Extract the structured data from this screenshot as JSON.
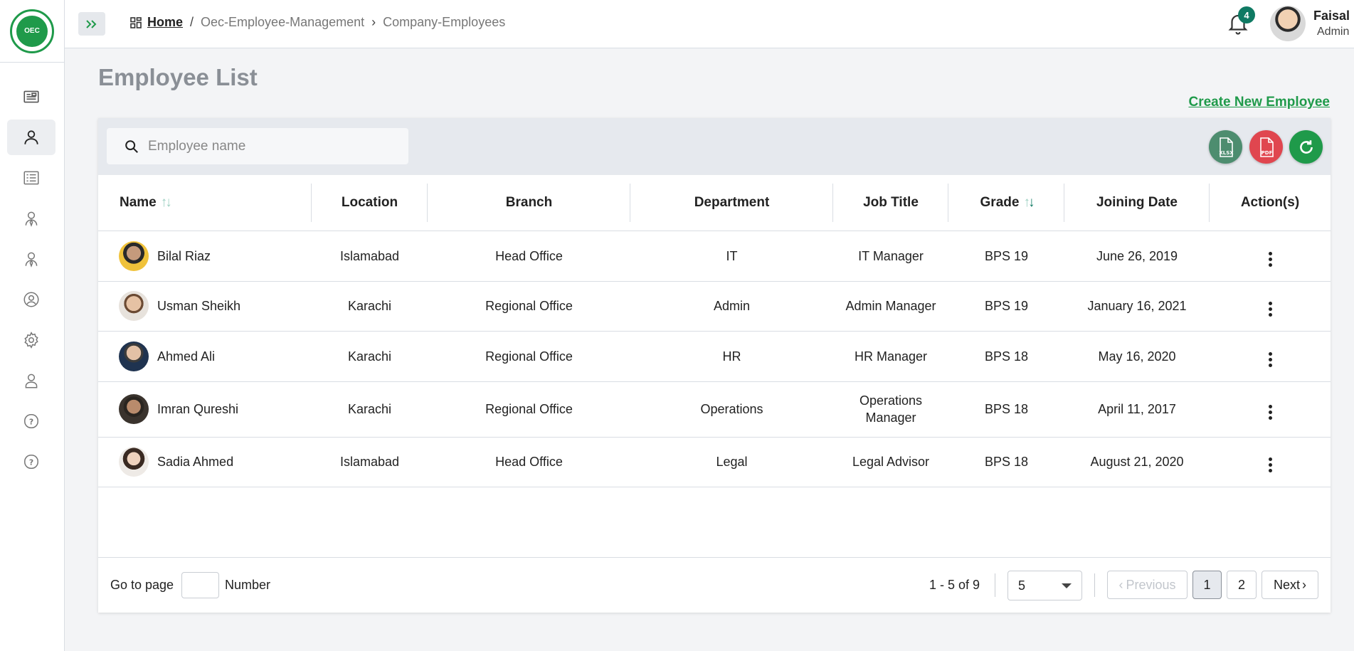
{
  "sidebar": {
    "logo_text": "OEC",
    "items": [
      {
        "icon": "id-card-icon"
      },
      {
        "icon": "user-icon",
        "active": true
      },
      {
        "icon": "list-icon"
      },
      {
        "icon": "employee-icon"
      },
      {
        "icon": "employee-alt-icon"
      },
      {
        "icon": "user-circle-icon"
      },
      {
        "icon": "gear-icon"
      },
      {
        "icon": "person-icon"
      },
      {
        "icon": "help-icon"
      },
      {
        "icon": "help-alt-icon"
      }
    ]
  },
  "breadcrumb": {
    "home": "Home",
    "sep1": "/",
    "module": "Oec-Employee-Management",
    "sep2": "›",
    "page": "Company-Employees"
  },
  "notifications": {
    "count": "4"
  },
  "user": {
    "name": "Faisal",
    "role": "Admin"
  },
  "page": {
    "title": "Employee List",
    "create_link": "Create New Employee"
  },
  "search": {
    "placeholder": "Employee name"
  },
  "toolbar": {
    "xlsx_label": "XLSX",
    "pdf_label": "PDF"
  },
  "table": {
    "columns": {
      "name": "Name",
      "location": "Location",
      "branch": "Branch",
      "department": "Department",
      "job_title": "Job Title",
      "grade": "Grade",
      "joining_date": "Joining Date",
      "actions": "Action(s)"
    },
    "rows": [
      {
        "name": "Bilal Riaz",
        "location": "Islamabad",
        "branch": "Head Office",
        "department": "IT",
        "job_title": "IT Manager",
        "grade": "BPS 19",
        "joining_date": "June 26, 2019"
      },
      {
        "name": "Usman Sheikh",
        "location": "Karachi",
        "branch": "Regional Office",
        "department": "Admin",
        "job_title": "Admin Manager",
        "grade": "BPS 19",
        "joining_date": "January 16, 2021"
      },
      {
        "name": "Ahmed Ali",
        "location": "Karachi",
        "branch": "Regional Office",
        "department": "HR",
        "job_title": "HR Manager",
        "grade": "BPS 18",
        "joining_date": "May 16, 2020"
      },
      {
        "name": "Imran Qureshi",
        "location": "Karachi",
        "branch": "Regional Office",
        "department": "Operations",
        "job_title": "Operations Manager",
        "grade": "BPS 18",
        "joining_date": "April 11, 2017"
      },
      {
        "name": "Sadia Ahmed",
        "location": "Islamabad",
        "branch": "Head Office",
        "department": "Legal",
        "job_title": "Legal Advisor",
        "grade": "BPS 18",
        "joining_date": "August 21, 2020"
      }
    ]
  },
  "pagination": {
    "goto_label": "Go to page",
    "goto_unit": "Number",
    "range": "1 - 5 of 9",
    "page_size": "5",
    "previous": "Previous",
    "next": "Next",
    "pages": [
      "1",
      "2"
    ],
    "current_page": "1"
  },
  "colors": {
    "brand_green": "#1f9a4a",
    "teal": "#0f7a63",
    "pdf_red": "#e0464f",
    "xlsx_green": "#4d8d6f"
  }
}
